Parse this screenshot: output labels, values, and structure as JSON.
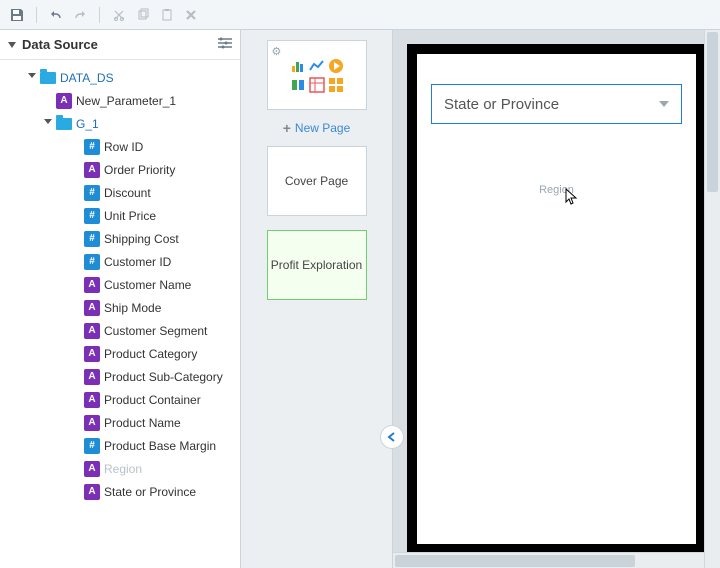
{
  "left_panel": {
    "title": "Data Source",
    "dataset": "DATA_DS",
    "param": "New_Parameter_1",
    "group": "G_1",
    "fields": [
      {
        "type": "hash",
        "name": "Row ID"
      },
      {
        "type": "a",
        "name": "Order Priority"
      },
      {
        "type": "hash",
        "name": "Discount"
      },
      {
        "type": "hash",
        "name": "Unit Price"
      },
      {
        "type": "hash",
        "name": "Shipping Cost"
      },
      {
        "type": "hash",
        "name": "Customer ID"
      },
      {
        "type": "a",
        "name": "Customer Name"
      },
      {
        "type": "a",
        "name": "Ship Mode"
      },
      {
        "type": "a",
        "name": "Customer Segment"
      },
      {
        "type": "a",
        "name": "Product Category"
      },
      {
        "type": "a",
        "name": "Product Sub-Category"
      },
      {
        "type": "a",
        "name": "Product Container"
      },
      {
        "type": "a",
        "name": "Product Name"
      },
      {
        "type": "hash",
        "name": "Product Base Margin"
      },
      {
        "type": "a",
        "name": "Region",
        "faded": true
      },
      {
        "type": "a",
        "name": "State or Province",
        "selected": true
      }
    ]
  },
  "mid_panel": {
    "new_page": "New Page",
    "pages": [
      {
        "label": "Cover Page",
        "active": false
      },
      {
        "label": "Profit Exploration",
        "active": true
      }
    ]
  },
  "canvas": {
    "dropdown_label": "State or Province",
    "drag_hint": "Region"
  }
}
